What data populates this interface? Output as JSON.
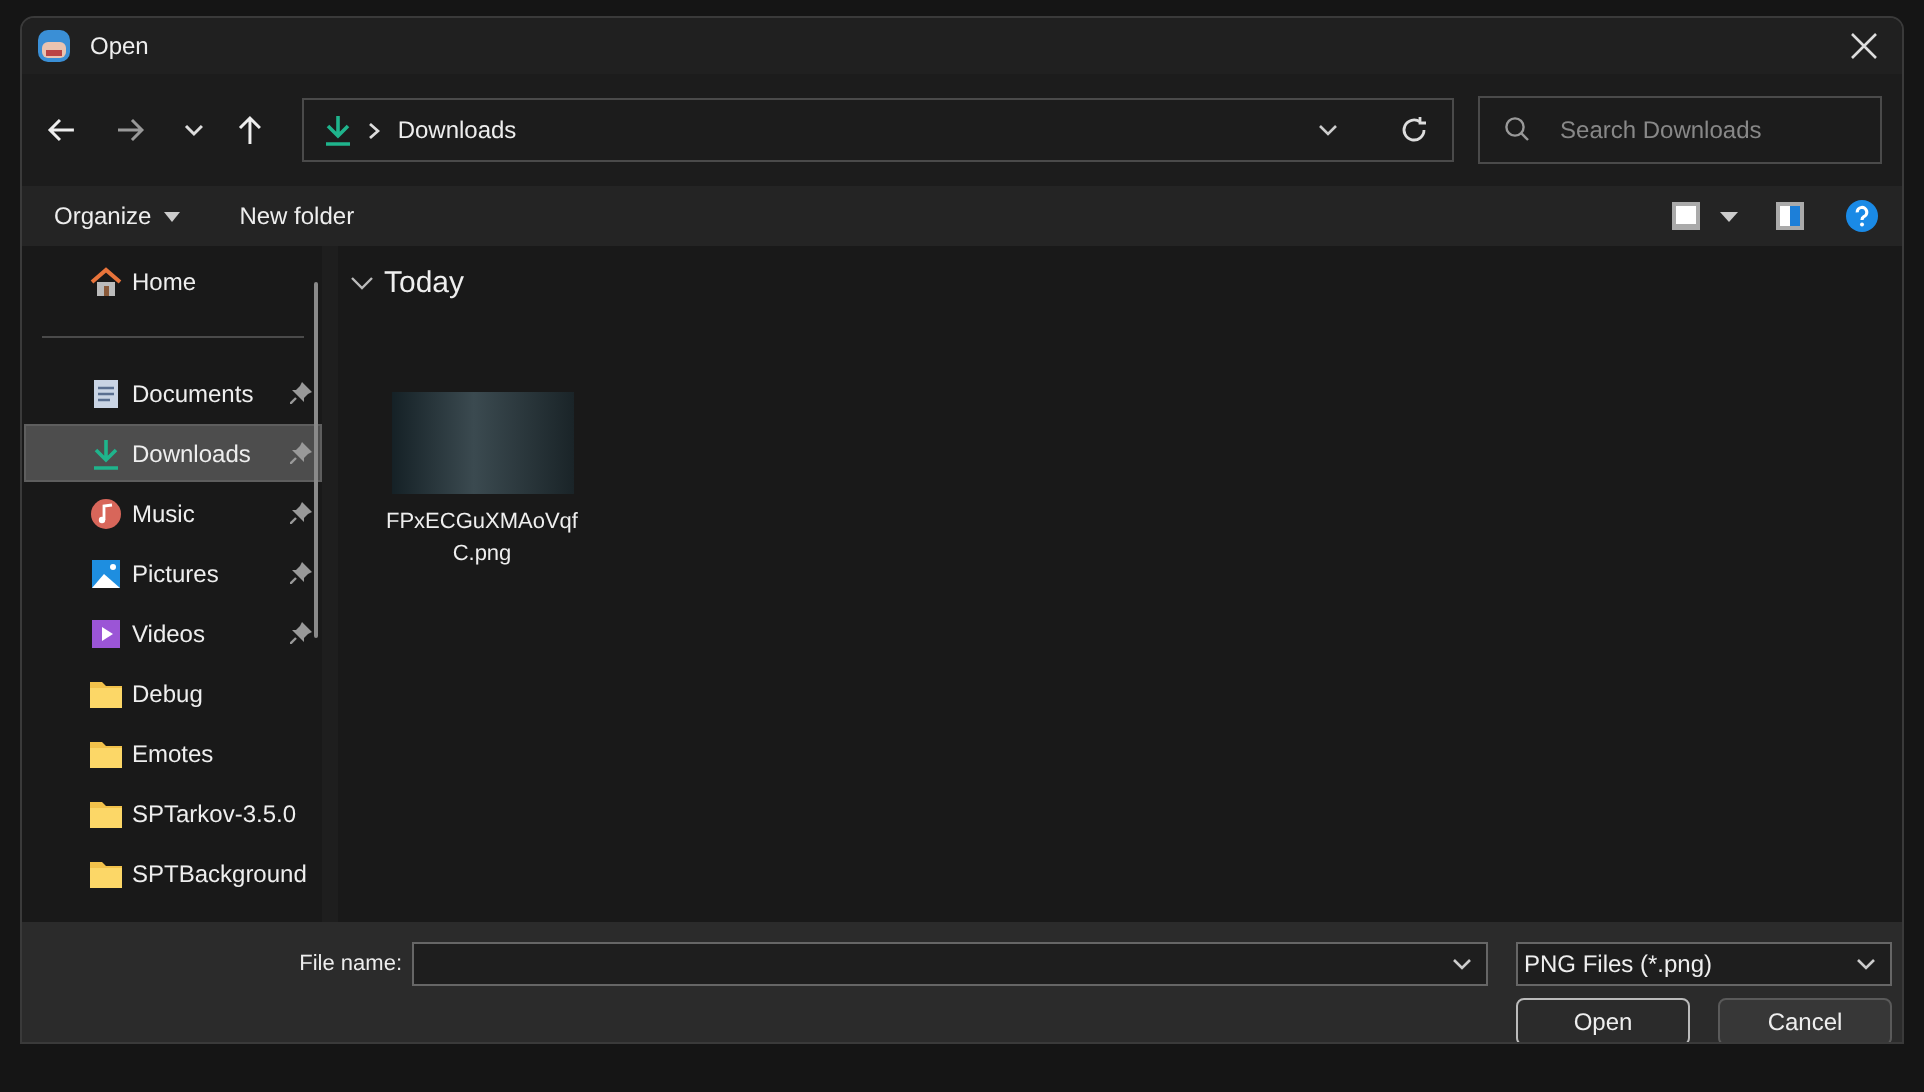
{
  "window": {
    "title": "Open"
  },
  "navigation": {
    "breadcrumb": [
      "Downloads"
    ],
    "search": {
      "placeholder": "Search Downloads"
    }
  },
  "command_bar": {
    "buttons": [
      "Organize",
      "New folder"
    ]
  },
  "sidebar": {
    "home": {
      "label": "Home",
      "selected": false
    },
    "items": [
      {
        "label": "Documents",
        "kind": "documents",
        "pinned": true,
        "selected": false
      },
      {
        "label": "Downloads",
        "kind": "downloads",
        "pinned": true,
        "selected": true
      },
      {
        "label": "Music",
        "kind": "music",
        "pinned": true,
        "selected": false
      },
      {
        "label": "Pictures",
        "kind": "pictures",
        "pinned": true,
        "selected": false
      },
      {
        "label": "Videos",
        "kind": "videos",
        "pinned": true,
        "selected": false
      },
      {
        "label": "Debug",
        "kind": "folder",
        "pinned": false,
        "selected": false
      },
      {
        "label": "Emotes",
        "kind": "folder",
        "pinned": false,
        "selected": false
      },
      {
        "label": "SPTarkov-3.5.0",
        "kind": "folder",
        "pinned": false,
        "selected": false
      },
      {
        "label": "SPTBackground",
        "kind": "folder",
        "pinned": false,
        "selected": false
      }
    ]
  },
  "content": {
    "groups": [
      {
        "title": "Today",
        "expanded": true,
        "files": [
          {
            "name": "FPxECGuXMAoVqfC.png",
            "selected": false
          }
        ]
      }
    ]
  },
  "footer": {
    "file_name_label": "File name:",
    "file_type": "PNG Files (*.png)",
    "buttons": [
      "Open",
      "Cancel"
    ]
  }
}
